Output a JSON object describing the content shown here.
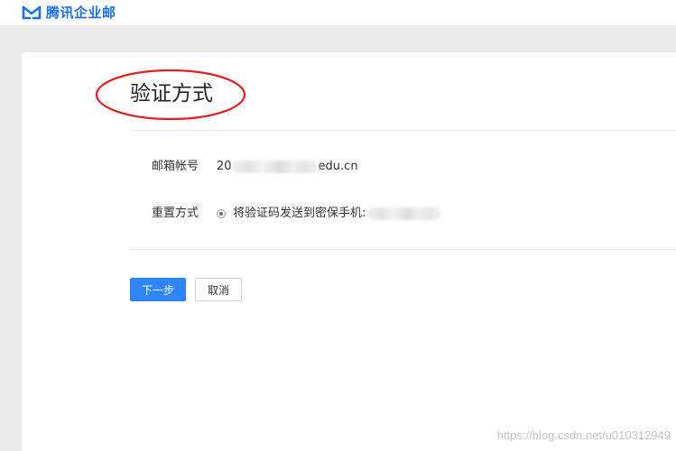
{
  "app": {
    "logo_text": "腾讯企业邮",
    "accent_color": "#1d6fe8"
  },
  "page": {
    "title": "验证方式"
  },
  "form": {
    "account_label": "邮箱帐号",
    "account_value_prefix": "20",
    "account_value_suffix": "edu.cn",
    "reset_label": "重置方式",
    "reset_option_label": "将验证码发送到密保手机:",
    "reset_option_selected": true
  },
  "actions": {
    "next_label": "下一步",
    "cancel_label": "取消",
    "primary_color": "#2f86f6"
  },
  "watermark": {
    "text": "https://blog.csdn.net/u010312949"
  },
  "annotation": {
    "ellipse_color": "#e02020"
  }
}
